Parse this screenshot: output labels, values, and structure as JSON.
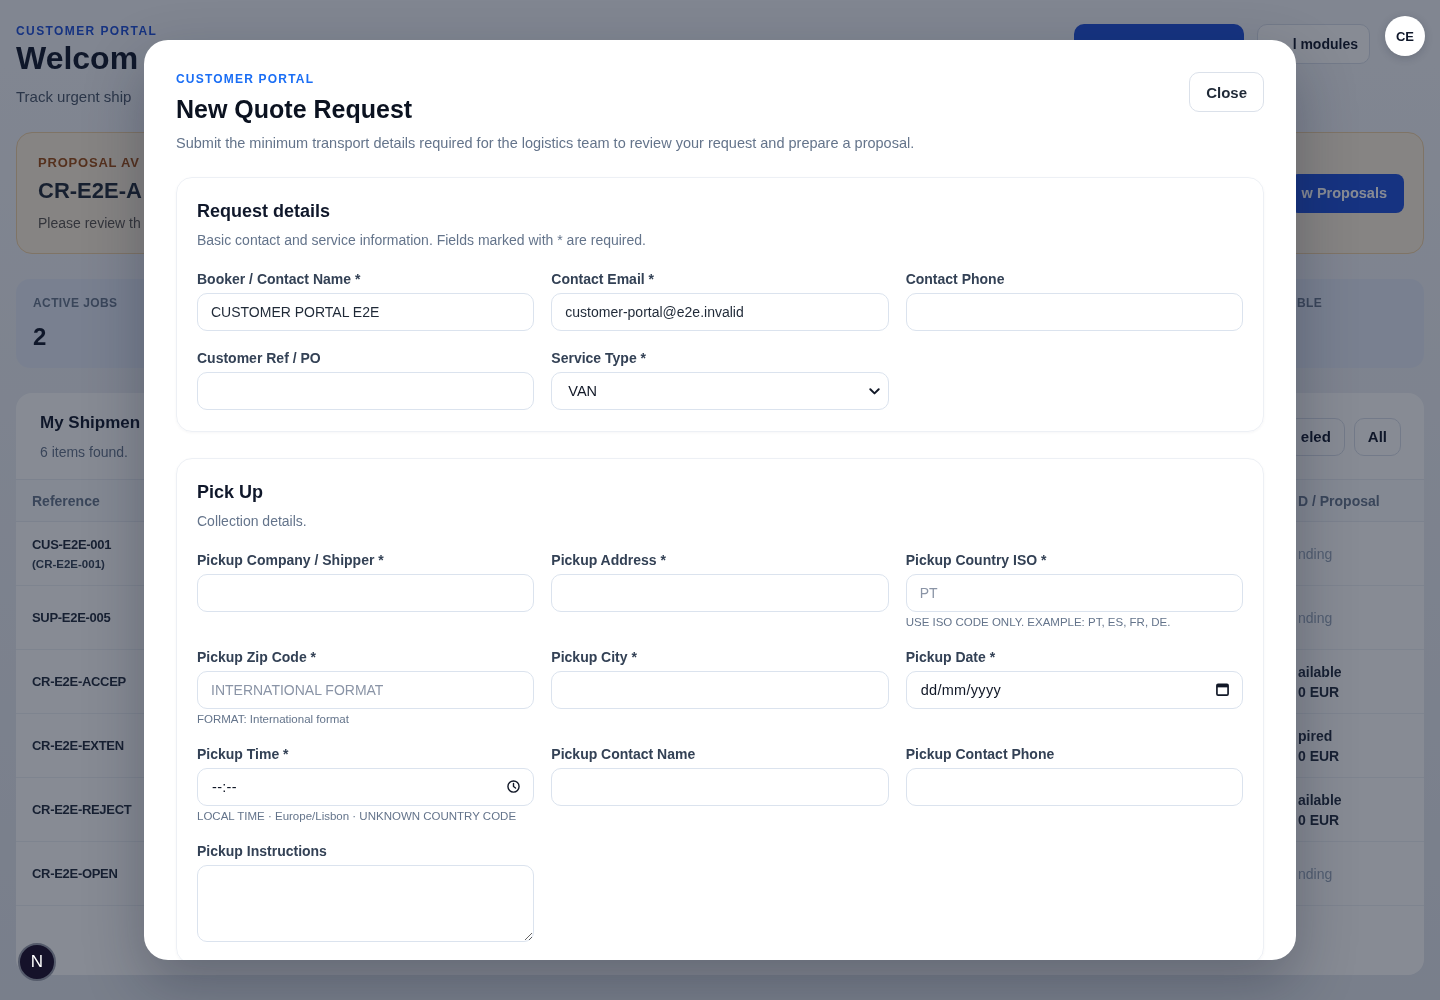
{
  "page": {
    "eyebrow": "CUSTOMER PORTAL",
    "title": "Welcom",
    "subtitle": "Track urgent ship",
    "actions": [
      {
        "kind": "primary"
      },
      {
        "kind": "outline",
        "label": "l modules"
      }
    ],
    "avatar": "CE",
    "proposal_banner": {
      "label": "PROPOSAL AV",
      "reference": "CR-E2E-A",
      "message": "Please review th",
      "button": "w Proposals"
    },
    "stats": [
      {
        "label": "ACTIVE JOBS",
        "value": "2"
      },
      {
        "label": "BLE"
      }
    ],
    "shipments": {
      "title": "My Shipmen",
      "count": "6 items found.",
      "filters": [
        {
          "label": "eled",
          "selected": false
        },
        {
          "label": "All",
          "selected": false
        }
      ],
      "columns": [
        "Reference",
        "D / Proposal"
      ],
      "rows": [
        {
          "kind": "muted",
          "reference": "CUS-E2E-001",
          "sub_reference": "(CR-E2E-001)",
          "proposal": {
            "status": "nding"
          }
        },
        {
          "kind": "muted",
          "reference": "SUP-E2E-005",
          "proposal": {
            "status": "nding"
          }
        },
        {
          "kind": "strong",
          "reference": "CR-E2E-ACCEP",
          "proposal": {
            "status": "ailable",
            "amount": "0 EUR"
          }
        },
        {
          "kind": "strong",
          "reference": "CR-E2E-EXTEN",
          "proposal": {
            "status": "pired",
            "amount": "0 EUR"
          }
        },
        {
          "kind": "strong",
          "reference": "CR-E2E-REJECT",
          "proposal": {
            "status": "ailable",
            "amount": "0 EUR"
          }
        },
        {
          "kind": "muted",
          "reference": "CR-E2E-OPEN",
          "proposal": {
            "status": "nding"
          }
        }
      ]
    }
  },
  "modal": {
    "eyebrow": "CUSTOMER PORTAL",
    "title": "New Quote Request",
    "description": "Submit the minimum transport details required for the logistics team to review your request and prepare a proposal.",
    "close_button": "Close",
    "sections": [
      {
        "title": "Request details",
        "description": "Basic contact and service information. Fields marked with * are required.",
        "fields": [
          {
            "label": "Booker / Contact Name *",
            "kind": "text",
            "value": "CUSTOMER PORTAL E2E"
          },
          {
            "label": "Contact Email *",
            "kind": "text",
            "value": "customer-portal@e2e.invalid"
          },
          {
            "label": "Contact Phone",
            "kind": "text"
          },
          {
            "label": "Customer Ref / PO",
            "kind": "text"
          },
          {
            "label": "Service Type *",
            "kind": "select",
            "value": "VAN"
          }
        ]
      },
      {
        "title": "Pick Up",
        "description": "Collection details.",
        "fields": [
          {
            "label": "Pickup Company / Shipper *",
            "kind": "text"
          },
          {
            "label": "Pickup Address *",
            "kind": "text"
          },
          {
            "label": "Pickup Country ISO *",
            "kind": "text",
            "placeholder": "PT",
            "hint": "USE ISO CODE ONLY. EXAMPLE: PT, ES, FR, DE."
          },
          {
            "label": "Pickup Zip Code *",
            "kind": "text",
            "placeholder": "INTERNATIONAL FORMAT",
            "hint": "FORMAT: International format"
          },
          {
            "label": "Pickup City *",
            "kind": "text"
          },
          {
            "label": "Pickup Date *",
            "kind": "date",
            "placeholder": "dd/mm/yyyy"
          },
          {
            "label": "Pickup Time *",
            "kind": "time",
            "placeholder": "--:--",
            "hint": "LOCAL TIME · Europe/Lisbon · UNKNOWN COUNTRY CODE"
          },
          {
            "label": "Pickup Contact Name",
            "kind": "text"
          },
          {
            "label": "Pickup Contact Phone",
            "kind": "text"
          },
          {
            "label": "Pickup Instructions",
            "kind": "textarea"
          }
        ]
      }
    ]
  },
  "dev_indicator": {
    "label": "N"
  }
}
